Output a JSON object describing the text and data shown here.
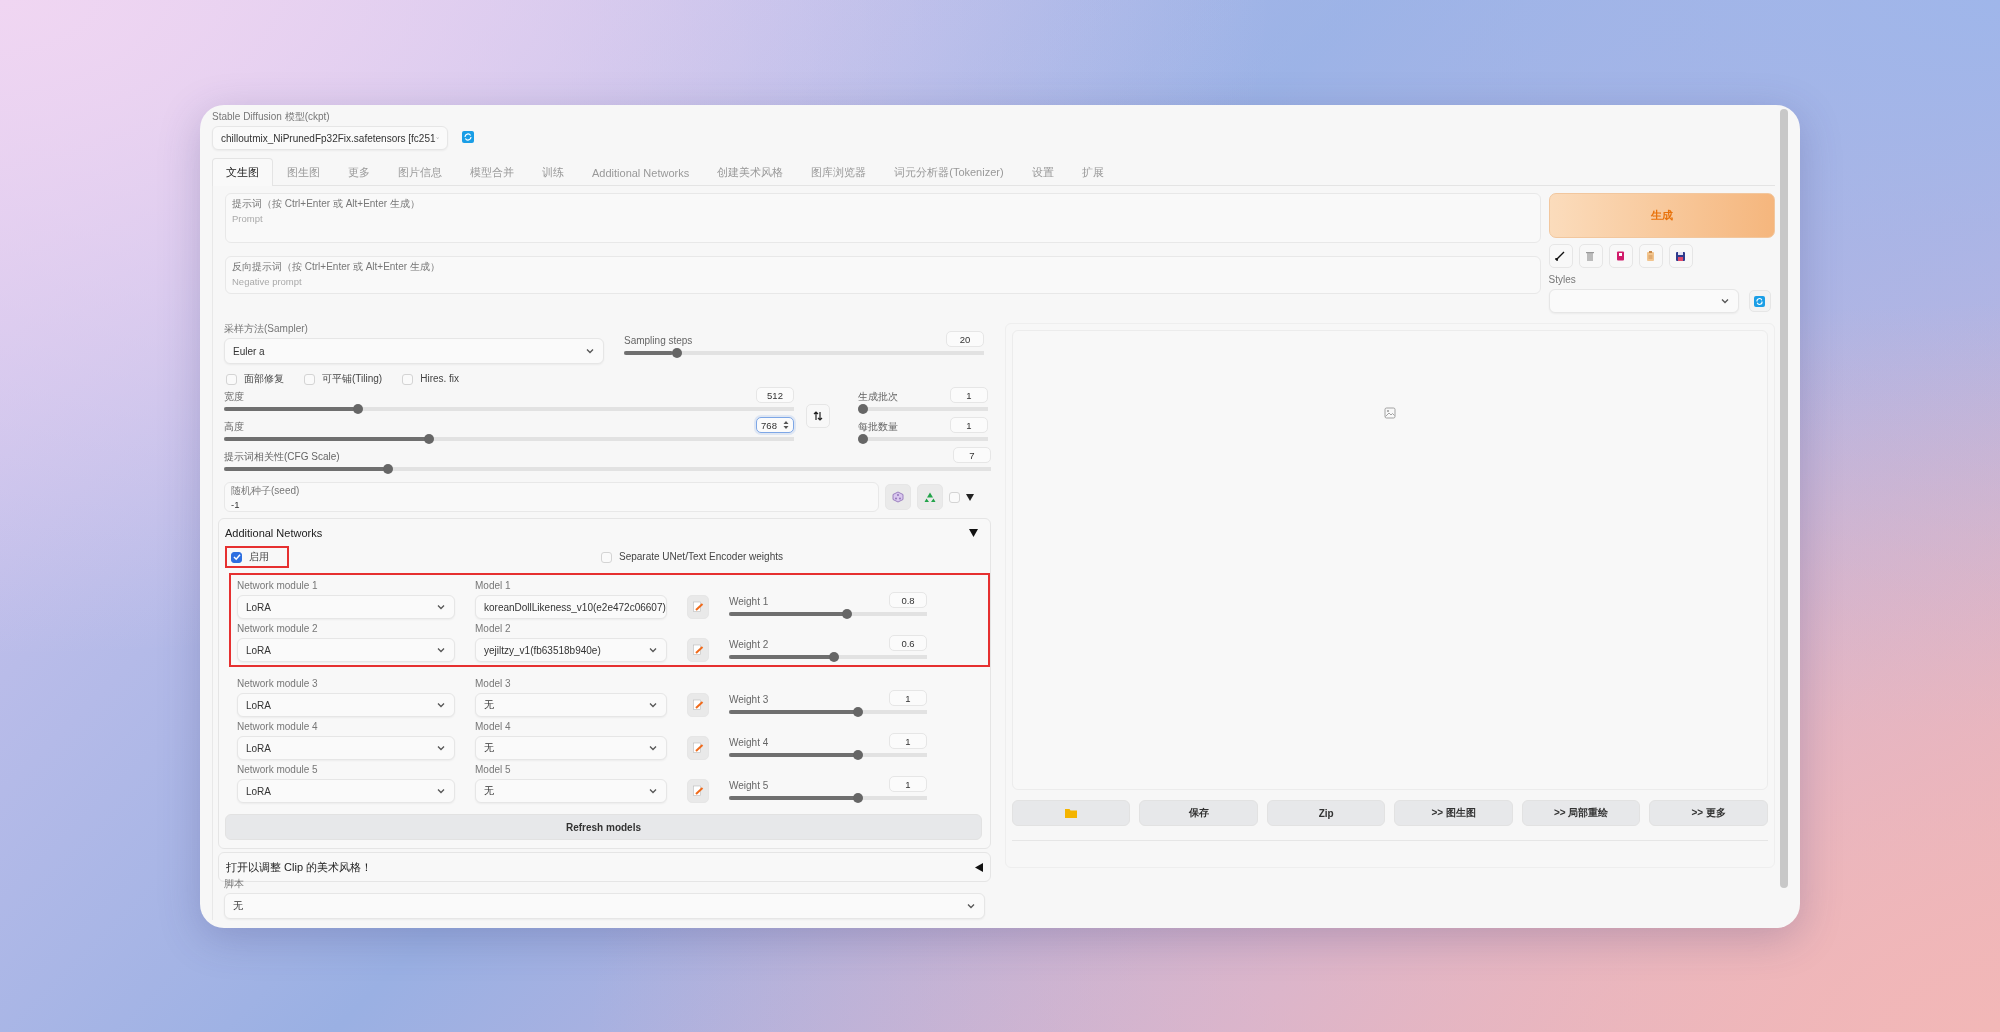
{
  "model_selector": {
    "label": "Stable Diffusion 模型(ckpt)",
    "value": "chilloutmix_NiPrunedFp32Fix.safetensors [fc251"
  },
  "tabs": [
    {
      "label": "文生图",
      "selected": true
    },
    {
      "label": "图生图",
      "selected": false
    },
    {
      "label": "更多",
      "selected": false
    },
    {
      "label": "图片信息",
      "selected": false
    },
    {
      "label": "模型合并",
      "selected": false
    },
    {
      "label": "训练",
      "selected": false
    },
    {
      "label": "Additional Networks",
      "selected": false
    },
    {
      "label": "创建美术风格",
      "selected": false
    },
    {
      "label": "图库浏览器",
      "selected": false
    },
    {
      "label": "词元分析器(Tokenizer)",
      "selected": false
    },
    {
      "label": "设置",
      "selected": false
    },
    {
      "label": "扩展",
      "selected": false
    }
  ],
  "prompt": {
    "label": "提示词（按 Ctrl+Enter 或 Alt+Enter 生成）",
    "placeholder": "Prompt"
  },
  "negative_prompt": {
    "label": "反向提示词（按 Ctrl+Enter 或 Alt+Enter 生成）",
    "placeholder": "Negative prompt"
  },
  "generate_button": "生成",
  "styles": {
    "label": "Styles"
  },
  "sampler": {
    "label": "采样方法(Sampler)",
    "value": "Euler a"
  },
  "sampling_steps": {
    "label": "Sampling steps",
    "value": "20",
    "level": 0.136,
    "focused": false
  },
  "options": [
    {
      "label": "面部修复",
      "checked": false
    },
    {
      "label": "可平铺(Tiling)",
      "checked": false
    },
    {
      "label": "Hires. fix",
      "checked": false
    }
  ],
  "width": {
    "label": "宽度",
    "value": "512",
    "level": 0.23,
    "focused": false
  },
  "height": {
    "label": "高度",
    "value": "768",
    "level": 0.357,
    "focused": true
  },
  "batch_count": {
    "label": "生成批次",
    "value": "1",
    "level": 0,
    "focused": false
  },
  "batch_size": {
    "label": "每批数量",
    "value": "1",
    "level": 0,
    "focused": false
  },
  "cfg_scale": {
    "label": "提示词相关性(CFG Scale)",
    "value": "7",
    "level": 0.21,
    "focused": false
  },
  "seed": {
    "label": "随机种子(seed)",
    "value": "-1",
    "extra_checked": false
  },
  "additional_networks": {
    "title": "Additional Networks",
    "expanded": true,
    "enable": {
      "label": "启用",
      "checked": true,
      "highlighted": true
    },
    "separate_weights": {
      "label": "Separate UNet/Text Encoder weights",
      "checked": false
    },
    "rows": [
      {
        "module_label": "Network module 1",
        "module": "LoRA",
        "model_label": "Model 1",
        "model": "koreanDollLikeness_v10(e2e472c06607)",
        "weight_label": "Weight 1",
        "weight": "0.8",
        "level": 0.6,
        "highlighted": true
      },
      {
        "module_label": "Network module 2",
        "module": "LoRA",
        "model_label": "Model 2",
        "model": "yejiltzy_v1(fb63518b940e)",
        "weight_label": "Weight 2",
        "weight": "0.6",
        "level": 0.53,
        "highlighted": true
      },
      {
        "module_label": "Network module 3",
        "module": "LoRA",
        "model_label": "Model 3",
        "model": "无",
        "weight_label": "Weight 3",
        "weight": "1",
        "level": 0.66,
        "highlighted": false
      },
      {
        "module_label": "Network module 4",
        "module": "LoRA",
        "model_label": "Model 4",
        "model": "无",
        "weight_label": "Weight 4",
        "weight": "1",
        "level": 0.66,
        "highlighted": false
      },
      {
        "module_label": "Network module 5",
        "module": "LoRA",
        "model_label": "Model 5",
        "model": "无",
        "weight_label": "Weight 5",
        "weight": "1",
        "level": 0.66,
        "highlighted": false
      }
    ],
    "refresh_button": "Refresh models"
  },
  "clip_accordion": {
    "title": "打开以调整 Clip 的美术风格！",
    "expanded": false
  },
  "script": {
    "label": "脚本",
    "value": "无"
  },
  "output_buttons": [
    {
      "kind": "folder"
    },
    {
      "kind": "text",
      "label": "保存"
    },
    {
      "kind": "text",
      "label": "Zip"
    },
    {
      "kind": "text",
      "label": ">> 图生图"
    },
    {
      "kind": "text",
      "label": ">> 局部重绘"
    },
    {
      "kind": "text",
      "label": ">> 更多"
    }
  ]
}
